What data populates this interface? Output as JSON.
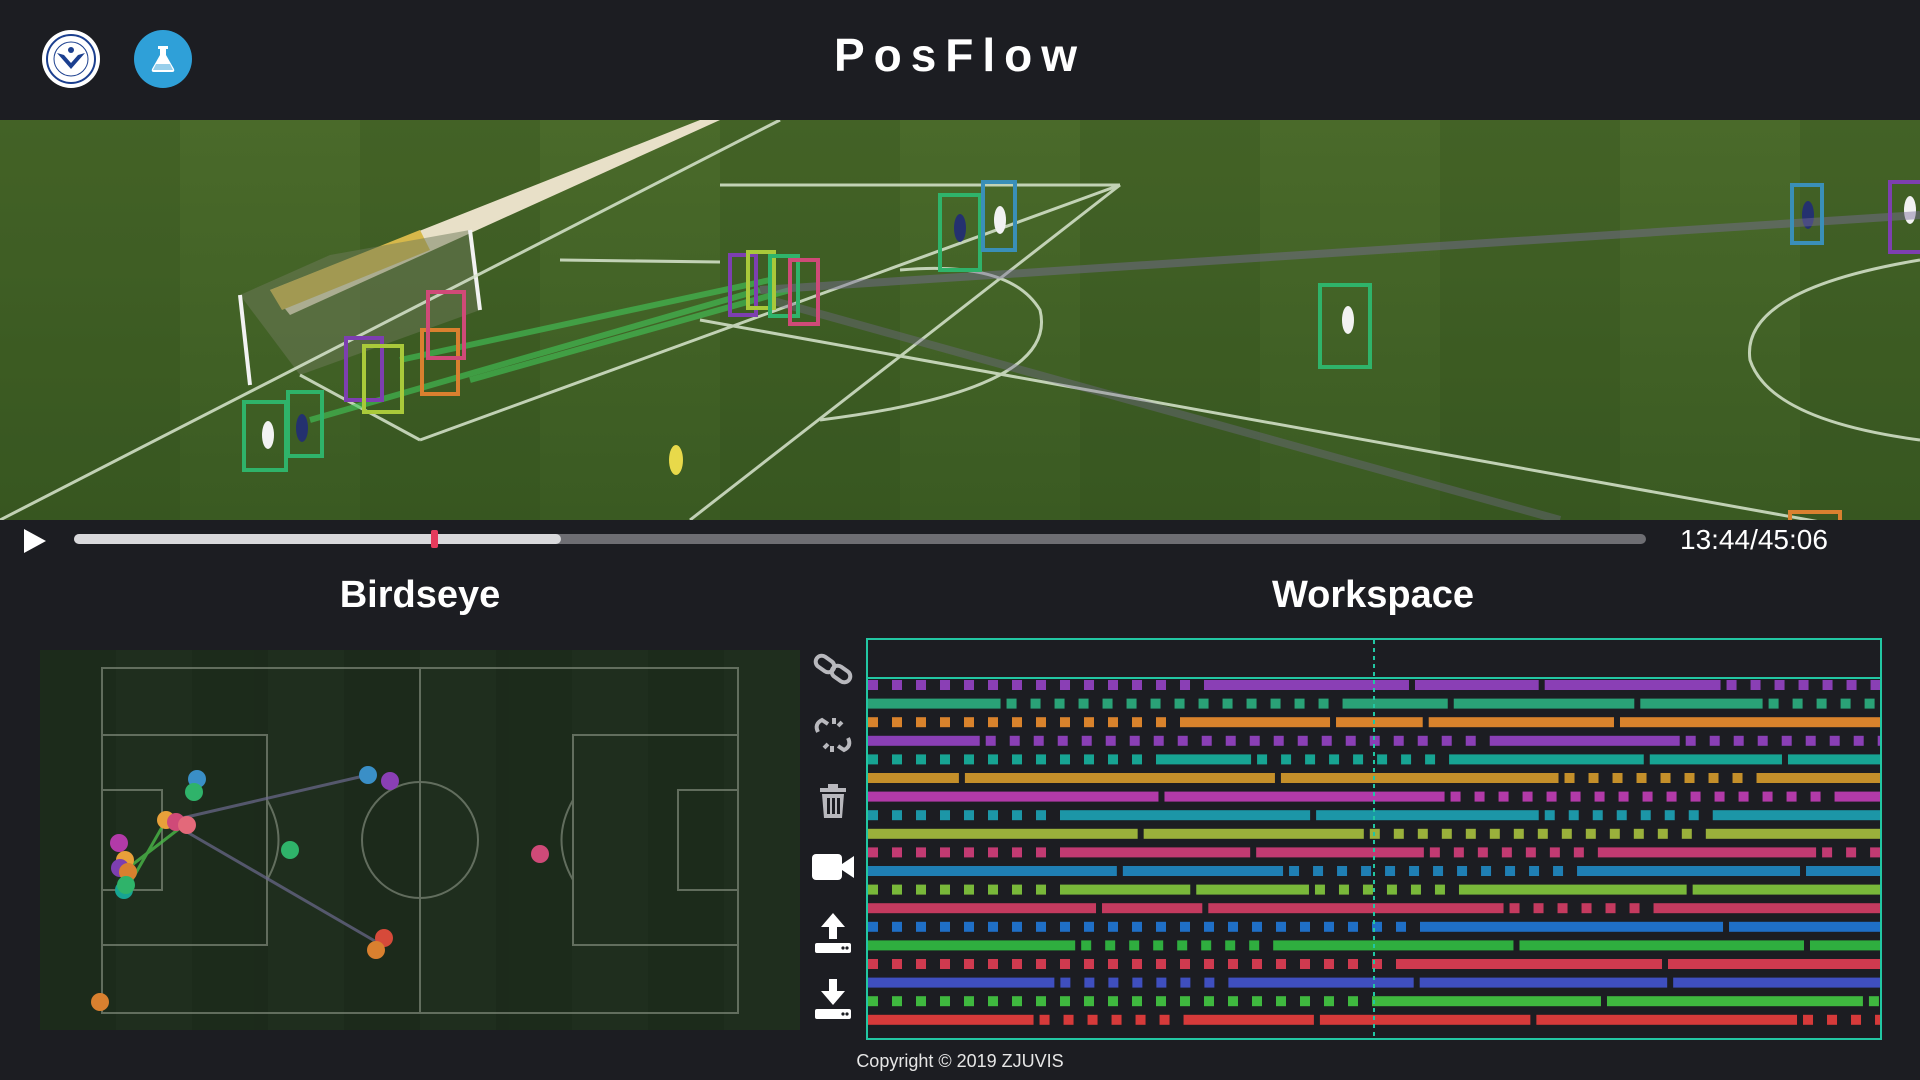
{
  "header": {
    "title": "PosFlow",
    "logo_left_icon": "university-seal-icon",
    "logo_right_icon": "flask-icon",
    "logo_right_color": "#2fa0d8"
  },
  "video": {
    "description_icon": "soccer-broadcast-frame",
    "box_colors": [
      "#2fb36a",
      "#3a8fb8",
      "#7d3fb0",
      "#a9c93a",
      "#d9802f",
      "#cf4a78"
    ]
  },
  "player": {
    "play_icon": "play-icon",
    "time": "13:44/45:06",
    "buffered_fraction": 0.31,
    "played_fraction": 0.227,
    "handle_color": "#e53b5c"
  },
  "birdseye": {
    "title": "Birdseye"
  },
  "workspace": {
    "title": "Workspace",
    "accent": "#22c7a3",
    "tools": [
      {
        "name": "link-icon"
      },
      {
        "name": "unlink-icon"
      },
      {
        "name": "trash-icon"
      },
      {
        "name": "video-camera-icon"
      },
      {
        "name": "upload-icon"
      },
      {
        "name": "download-icon"
      }
    ],
    "track_colors": [
      "#8a3fb5",
      "#2aa277",
      "#d9832c",
      "#8a3fb5",
      "#17a493",
      "#c48f2a",
      "#b23aa8",
      "#1c96a7",
      "#9ab13b",
      "#c23a72",
      "#1f7fb4",
      "#79b83a",
      "#c43a5f",
      "#1f6fc6",
      "#2fae3f",
      "#cf3a4f",
      "#3f4fbf",
      "#3fb83f",
      "#d63a3a"
    ]
  },
  "footer": {
    "copyright": "Copyright © 2019 ZJUVIS"
  }
}
